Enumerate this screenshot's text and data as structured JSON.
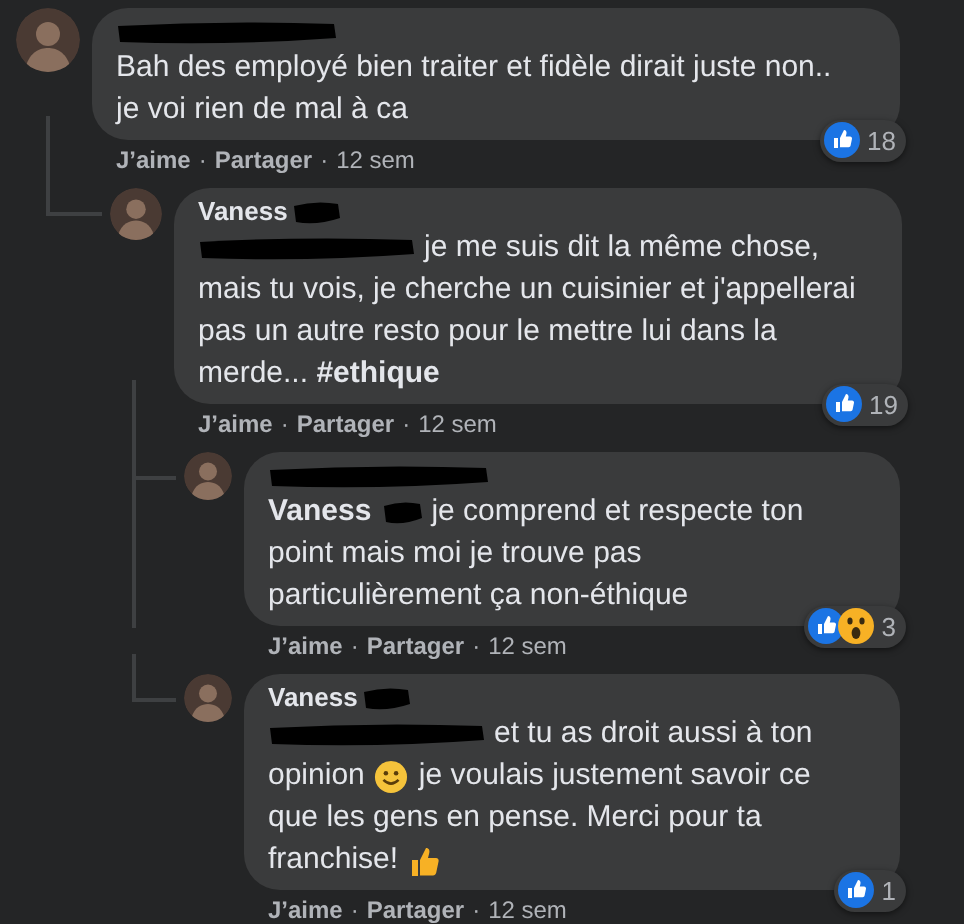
{
  "comments": [
    {
      "author_redacted": true,
      "lines": [
        [
          {
            "kind": "text",
            "text": "Bah des employé bien traiter et fidèle dirait juste non.."
          }
        ],
        [
          {
            "kind": "text",
            "text": "je voi rien de mal à ca"
          }
        ]
      ],
      "reactions": [
        {
          "kind": "like"
        }
      ],
      "reaction_count": "18",
      "actions": [
        "J’aime",
        "Partager"
      ],
      "separator": "·",
      "time": "12 sem",
      "children": [
        {
          "author": "Vaness",
          "author_redacted": true,
          "lines": [
            [
              {
                "kind": "redacted"
              },
              {
                "kind": "text",
                "text": "je me suis dit la même chose,"
              }
            ],
            [
              {
                "kind": "text",
                "text": "mais tu vois, je cherche un cuisinier et j'appellerai"
              }
            ],
            [
              {
                "kind": "text",
                "text": "pas un autre resto pour le mettre lui dans la"
              }
            ],
            [
              {
                "kind": "text",
                "text": "merde... **#ethique**"
              }
            ]
          ],
          "reactions": [
            {
              "kind": "like"
            }
          ],
          "reaction_count": "19",
          "actions": [
            "J’aime",
            "Partager"
          ],
          "separator": "·",
          "time": "12 sem",
          "children": [
            {
              "author_redacted": true,
              "lines": [
                [
                  {
                    "kind": "mention",
                    "text": "Vaness"
                  },
                  {
                    "kind": "redacted"
                  },
                  {
                    "kind": "text",
                    "text": "je comprend et respecte ton"
                  }
                ],
                [
                  {
                    "kind": "text",
                    "text": "point mais moi je trouve pas"
                  }
                ],
                [
                  {
                    "kind": "text",
                    "text": "particulièrement ça non-éthique"
                  }
                ]
              ],
              "reactions": [
                {
                  "kind": "like"
                },
                {
                  "kind": "wow"
                }
              ],
              "reaction_count": "3",
              "actions": [
                "J’aime",
                "Partager"
              ],
              "separator": "·",
              "time": "12 sem"
            },
            {
              "author": "Vaness",
              "author_redacted": true,
              "lines": [
                [
                  {
                    "kind": "redacted"
                  },
                  {
                    "kind": "text",
                    "text": "et tu as droit aussi à ton"
                  }
                ],
                [
                  {
                    "kind": "text",
                    "text": "opinion"
                  },
                  {
                    "kind": "smiley"
                  },
                  {
                    "kind": "text",
                    "text": "je voulais justement savoir ce"
                  }
                ],
                [
                  {
                    "kind": "text",
                    "text": "que les gens en pense. Merci pour ta"
                  }
                ],
                [
                  {
                    "kind": "text",
                    "text": "franchise!"
                  },
                  {
                    "kind": "thumbs-up"
                  }
                ]
              ],
              "reactions": [
                {
                  "kind": "like"
                }
              ],
              "reaction_count": "1",
              "actions": [
                "J’aime",
                "Partager"
              ],
              "separator": "·",
              "time": "12 sem"
            }
          ]
        }
      ]
    }
  ]
}
